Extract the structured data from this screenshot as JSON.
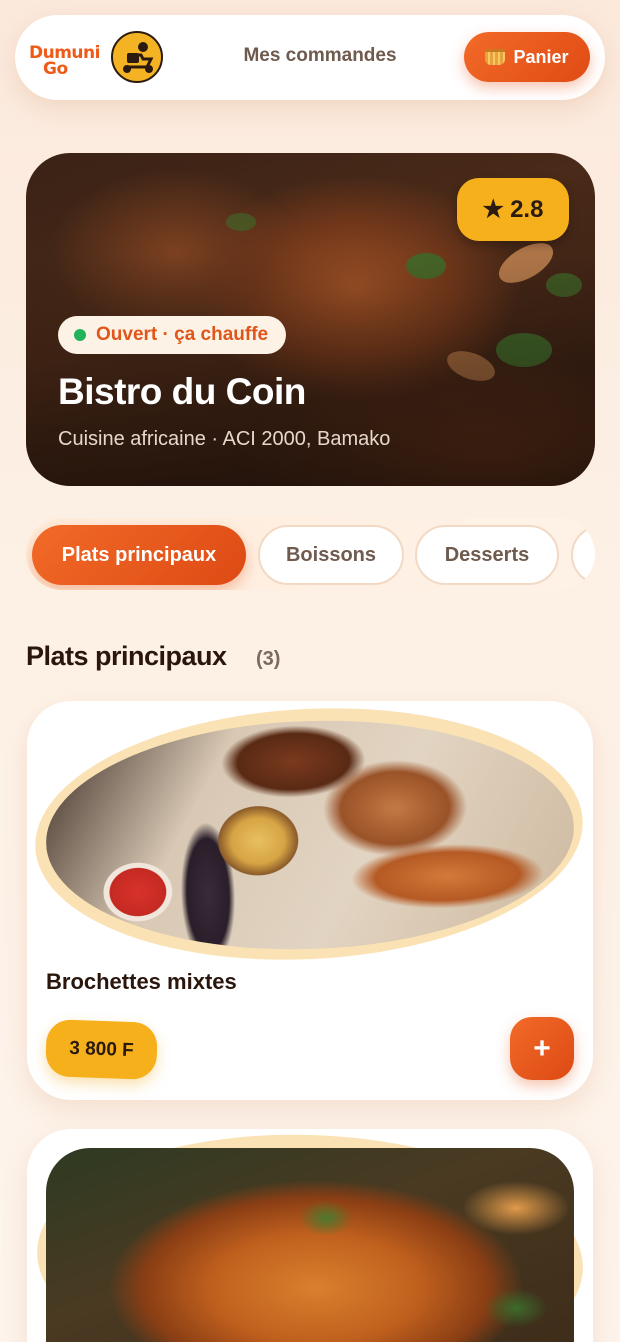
{
  "header": {
    "logo_line1": "Dumuni",
    "logo_line2": "Go",
    "orders_label": "Mes commandes",
    "cart_label": "Panier",
    "cart_icon": "basket-icon"
  },
  "restaurant": {
    "rating": "2.8",
    "rating_icon": "star-icon",
    "status": "Ouvert · ça chauffe",
    "name": "Bistro du Coin",
    "subtitle": "Cuisine africaine · ACI 2000, Bamako"
  },
  "tabs": [
    {
      "label": "Plats principaux",
      "active": true
    },
    {
      "label": "Boissons",
      "active": false
    },
    {
      "label": "Desserts",
      "active": false
    }
  ],
  "section": {
    "title": "Plats principaux",
    "count": "(3)"
  },
  "dishes": [
    {
      "name": "Brochettes mixtes",
      "price": "3 800 F",
      "add_label": "+"
    },
    {
      "name": "",
      "price": "",
      "add_label": ""
    }
  ],
  "colors": {
    "accent": "#ee5a17",
    "gold": "#f6b01c",
    "status_green": "#22b35a"
  }
}
